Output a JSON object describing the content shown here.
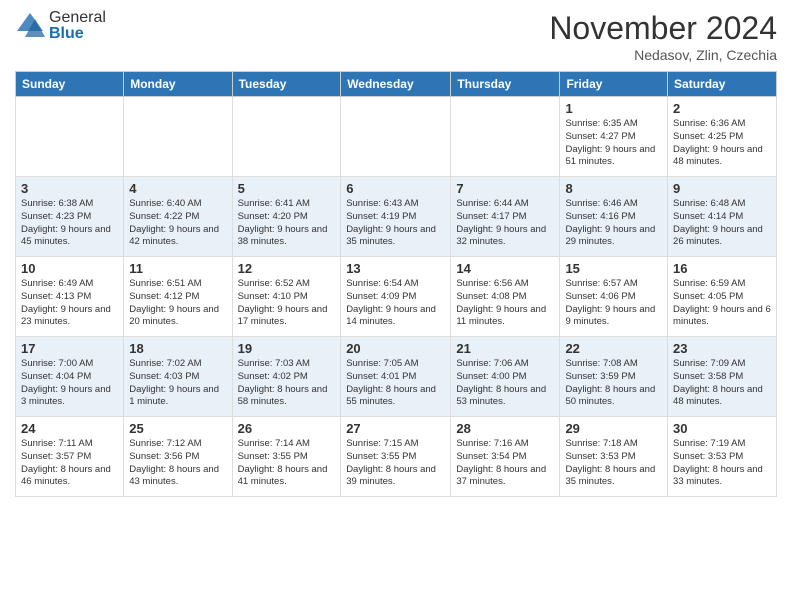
{
  "logo": {
    "general": "General",
    "blue": "Blue"
  },
  "title": "November 2024",
  "location": "Nedasov, Zlin, Czechia",
  "days_of_week": [
    "Sunday",
    "Monday",
    "Tuesday",
    "Wednesday",
    "Thursday",
    "Friday",
    "Saturday"
  ],
  "weeks": [
    [
      {
        "day": "",
        "info": ""
      },
      {
        "day": "",
        "info": ""
      },
      {
        "day": "",
        "info": ""
      },
      {
        "day": "",
        "info": ""
      },
      {
        "day": "",
        "info": ""
      },
      {
        "day": "1",
        "info": "Sunrise: 6:35 AM\nSunset: 4:27 PM\nDaylight: 9 hours and 51 minutes."
      },
      {
        "day": "2",
        "info": "Sunrise: 6:36 AM\nSunset: 4:25 PM\nDaylight: 9 hours and 48 minutes."
      }
    ],
    [
      {
        "day": "3",
        "info": "Sunrise: 6:38 AM\nSunset: 4:23 PM\nDaylight: 9 hours and 45 minutes."
      },
      {
        "day": "4",
        "info": "Sunrise: 6:40 AM\nSunset: 4:22 PM\nDaylight: 9 hours and 42 minutes."
      },
      {
        "day": "5",
        "info": "Sunrise: 6:41 AM\nSunset: 4:20 PM\nDaylight: 9 hours and 38 minutes."
      },
      {
        "day": "6",
        "info": "Sunrise: 6:43 AM\nSunset: 4:19 PM\nDaylight: 9 hours and 35 minutes."
      },
      {
        "day": "7",
        "info": "Sunrise: 6:44 AM\nSunset: 4:17 PM\nDaylight: 9 hours and 32 minutes."
      },
      {
        "day": "8",
        "info": "Sunrise: 6:46 AM\nSunset: 4:16 PM\nDaylight: 9 hours and 29 minutes."
      },
      {
        "day": "9",
        "info": "Sunrise: 6:48 AM\nSunset: 4:14 PM\nDaylight: 9 hours and 26 minutes."
      }
    ],
    [
      {
        "day": "10",
        "info": "Sunrise: 6:49 AM\nSunset: 4:13 PM\nDaylight: 9 hours and 23 minutes."
      },
      {
        "day": "11",
        "info": "Sunrise: 6:51 AM\nSunset: 4:12 PM\nDaylight: 9 hours and 20 minutes."
      },
      {
        "day": "12",
        "info": "Sunrise: 6:52 AM\nSunset: 4:10 PM\nDaylight: 9 hours and 17 minutes."
      },
      {
        "day": "13",
        "info": "Sunrise: 6:54 AM\nSunset: 4:09 PM\nDaylight: 9 hours and 14 minutes."
      },
      {
        "day": "14",
        "info": "Sunrise: 6:56 AM\nSunset: 4:08 PM\nDaylight: 9 hours and 11 minutes."
      },
      {
        "day": "15",
        "info": "Sunrise: 6:57 AM\nSunset: 4:06 PM\nDaylight: 9 hours and 9 minutes."
      },
      {
        "day": "16",
        "info": "Sunrise: 6:59 AM\nSunset: 4:05 PM\nDaylight: 9 hours and 6 minutes."
      }
    ],
    [
      {
        "day": "17",
        "info": "Sunrise: 7:00 AM\nSunset: 4:04 PM\nDaylight: 9 hours and 3 minutes."
      },
      {
        "day": "18",
        "info": "Sunrise: 7:02 AM\nSunset: 4:03 PM\nDaylight: 9 hours and 1 minute."
      },
      {
        "day": "19",
        "info": "Sunrise: 7:03 AM\nSunset: 4:02 PM\nDaylight: 8 hours and 58 minutes."
      },
      {
        "day": "20",
        "info": "Sunrise: 7:05 AM\nSunset: 4:01 PM\nDaylight: 8 hours and 55 minutes."
      },
      {
        "day": "21",
        "info": "Sunrise: 7:06 AM\nSunset: 4:00 PM\nDaylight: 8 hours and 53 minutes."
      },
      {
        "day": "22",
        "info": "Sunrise: 7:08 AM\nSunset: 3:59 PM\nDaylight: 8 hours and 50 minutes."
      },
      {
        "day": "23",
        "info": "Sunrise: 7:09 AM\nSunset: 3:58 PM\nDaylight: 8 hours and 48 minutes."
      }
    ],
    [
      {
        "day": "24",
        "info": "Sunrise: 7:11 AM\nSunset: 3:57 PM\nDaylight: 8 hours and 46 minutes."
      },
      {
        "day": "25",
        "info": "Sunrise: 7:12 AM\nSunset: 3:56 PM\nDaylight: 8 hours and 43 minutes."
      },
      {
        "day": "26",
        "info": "Sunrise: 7:14 AM\nSunset: 3:55 PM\nDaylight: 8 hours and 41 minutes."
      },
      {
        "day": "27",
        "info": "Sunrise: 7:15 AM\nSunset: 3:55 PM\nDaylight: 8 hours and 39 minutes."
      },
      {
        "day": "28",
        "info": "Sunrise: 7:16 AM\nSunset: 3:54 PM\nDaylight: 8 hours and 37 minutes."
      },
      {
        "day": "29",
        "info": "Sunrise: 7:18 AM\nSunset: 3:53 PM\nDaylight: 8 hours and 35 minutes."
      },
      {
        "day": "30",
        "info": "Sunrise: 7:19 AM\nSunset: 3:53 PM\nDaylight: 8 hours and 33 minutes."
      }
    ]
  ]
}
